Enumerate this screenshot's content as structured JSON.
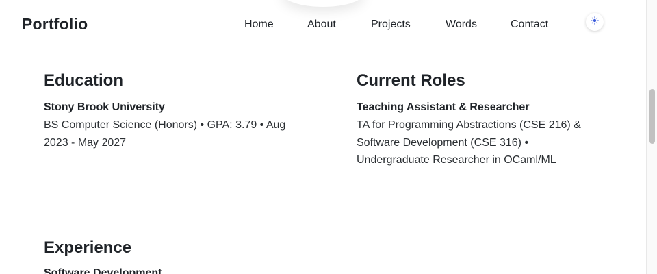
{
  "header": {
    "brand": "Portfolio",
    "nav": [
      "Home",
      "About",
      "Projects",
      "Words",
      "Contact"
    ],
    "theme_toggle_icon": "sun-icon",
    "accent_color": "#3b5bdb"
  },
  "education": {
    "title": "Education",
    "school": "Stony Brook University",
    "details": "BS Computer Science (Honors) • GPA: 3.79 • Aug 2023 - May 2027"
  },
  "roles": {
    "title": "Current Roles",
    "role": "Teaching Assistant & Researcher",
    "details": "TA for Programming Abstractions (CSE 216) & Software Development (CSE 316) • Undergraduate Researcher in OCaml/ML"
  },
  "experience": {
    "title": "Experience",
    "first_item": "Software Development"
  }
}
